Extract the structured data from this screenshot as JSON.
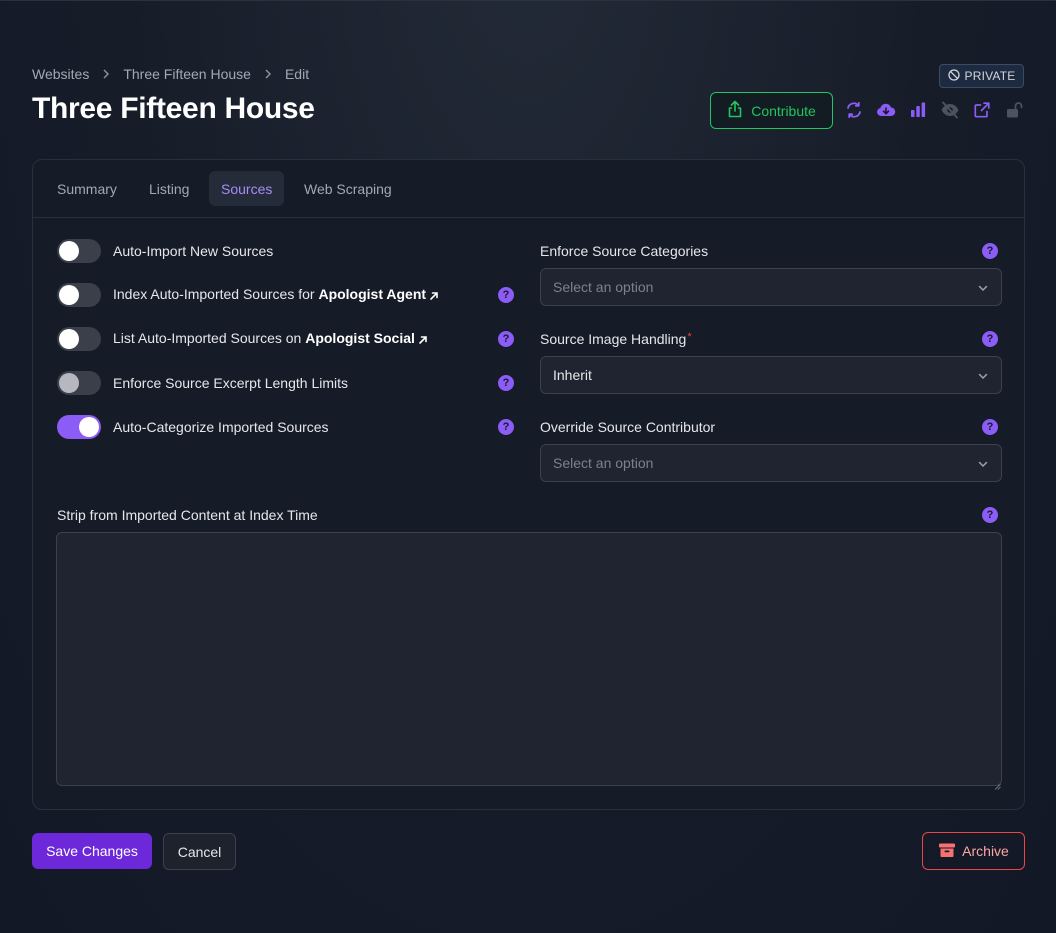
{
  "breadcrumb": {
    "items": [
      "Websites",
      "Three Fifteen House",
      "Edit"
    ]
  },
  "page": {
    "title": "Three Fifteen House"
  },
  "header": {
    "visibility_badge": "PRIVATE",
    "contribute_label": "Contribute",
    "icons": [
      "refresh-icon",
      "cloud-download-icon",
      "bar-chart-icon",
      "eye-off-icon",
      "external-link-icon",
      "lock-open-icon"
    ]
  },
  "tabs": [
    {
      "label": "Summary",
      "active": false
    },
    {
      "label": "Listing",
      "active": false
    },
    {
      "label": "Sources",
      "active": true
    },
    {
      "label": "Web Scraping",
      "active": false
    }
  ],
  "toggles": [
    {
      "label": "Auto-Import New Sources",
      "on": false
    },
    {
      "label_prefix": "Index Auto-Imported Sources for ",
      "label_bold": "Apologist Agent",
      "on": false
    },
    {
      "label_prefix": "List Auto-Imported Sources on ",
      "label_bold": "Apologist Social",
      "on": false
    },
    {
      "label": "Enforce Source Excerpt Length Limits",
      "on": false,
      "disabled": true
    },
    {
      "label": "Auto-Categorize Imported Sources",
      "on": true
    }
  ],
  "fields": {
    "enforce_categories": {
      "label": "Enforce Source Categories",
      "placeholder": "Select an option"
    },
    "image_handling": {
      "label": "Source Image Handling",
      "required_mark": "*",
      "value": "Inherit"
    },
    "override_contributor": {
      "label": "Override Source Contributor",
      "placeholder": "Select an option"
    },
    "strip_content": {
      "label": "Strip from Imported Content at Index Time",
      "value": ""
    }
  },
  "help_glyph": "?",
  "actions": {
    "save": "Save Changes",
    "cancel": "Cancel",
    "archive": "Archive"
  },
  "colors": {
    "accent": "#8b5cf6",
    "success": "#22c55e",
    "danger": "#ef4444",
    "background": "#121826"
  }
}
